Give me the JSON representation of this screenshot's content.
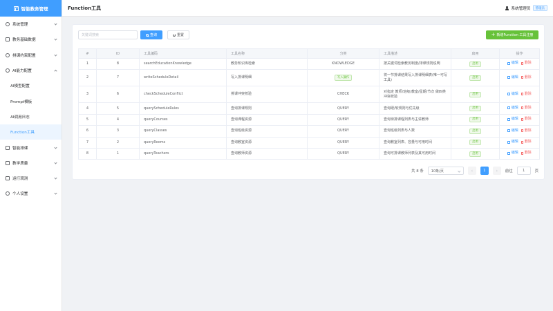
{
  "app": {
    "title": "智能教务管理"
  },
  "sidebar": {
    "items": [
      {
        "label": "系统管理",
        "icon": "gear-icon",
        "expanded": false
      },
      {
        "label": "教务基础数据",
        "icon": "monitor-icon",
        "expanded": false
      },
      {
        "label": "排课约束配置",
        "icon": "sliders-icon",
        "expanded": false
      },
      {
        "label": "AI能力配置",
        "icon": "ai-icon",
        "expanded": true
      },
      {
        "label": "智能排课",
        "icon": "calendar-icon",
        "expanded": false
      },
      {
        "label": "教学质量",
        "icon": "checkbox-icon",
        "expanded": false
      },
      {
        "label": "运行观测",
        "icon": "monitor-icon",
        "expanded": false
      },
      {
        "label": "个人设置",
        "icon": "user-icon",
        "expanded": false
      }
    ],
    "submenu": [
      {
        "label": "AI模型配置",
        "active": false
      },
      {
        "label": "Prompt模板",
        "active": false
      },
      {
        "label": "AI调用日志",
        "active": false
      },
      {
        "label": "Function工具",
        "active": true
      }
    ]
  },
  "header": {
    "title": "Function工具",
    "user": "系统管理员",
    "role": "管理员"
  },
  "toolbar": {
    "search_placeholder": "关键词搜索",
    "query_label": "查询",
    "reset_label": "重置",
    "add_label": "新增Function 工具注册"
  },
  "table": {
    "columns": [
      "#",
      "ID",
      "工具编码",
      "工具名称",
      "分类",
      "工具描述",
      "启用",
      "操作"
    ],
    "rows": [
      {
        "idx": "1",
        "id": "8",
        "code": "searchEducationKnowledge",
        "name": "教务知识库检索",
        "category": "KNOWLEDGE",
        "desc": "按关键词检索教务制度/排课规则说明",
        "status": "启用",
        "write": false
      },
      {
        "idx": "2",
        "id": "7",
        "code": "writeScheduleDetail",
        "name": "写入排课明细",
        "category": "写入操作",
        "desc": "将一节排课结果写入排课明细表(唯一可写工具)",
        "status": "启用",
        "write": true
      },
      {
        "idx": "3",
        "id": "6",
        "code": "checkScheduleConflict",
        "name": "排课冲突校验",
        "category": "CHECK",
        "desc": "对指定 教师/班级/教室/星期/节次 做四类冲突校验",
        "status": "启用",
        "write": false
      },
      {
        "idx": "4",
        "id": "5",
        "code": "queryScheduleRules",
        "name": "查询排课规则",
        "category": "QUERY",
        "desc": "查询硬/软规则与优先级",
        "status": "启用",
        "write": false
      },
      {
        "idx": "5",
        "id": "4",
        "code": "queryCourses",
        "name": "查询课程资源",
        "category": "QUERY",
        "desc": "查询待排课程列表与主讲教师",
        "status": "启用",
        "write": false
      },
      {
        "idx": "6",
        "id": "3",
        "code": "queryClasses",
        "name": "查询班级资源",
        "category": "QUERY",
        "desc": "查询班级列表与人数",
        "status": "启用",
        "write": false
      },
      {
        "idx": "7",
        "id": "2",
        "code": "queryRooms",
        "name": "查询教室资源",
        "category": "QUERY",
        "desc": "查询教室列表、容量与可用时间",
        "status": "启用",
        "write": false
      },
      {
        "idx": "8",
        "id": "1",
        "code": "queryTeachers",
        "name": "查询教师资源",
        "category": "QUERY",
        "desc": "查询可排课教师列表及其可用时间",
        "status": "启用",
        "write": false
      }
    ],
    "edit_label": "编辑",
    "delete_label": "删除"
  },
  "pagination": {
    "total_text": "共 8 条",
    "page_size": "10条/页",
    "current_page": "1",
    "goto_label": "前往",
    "goto_value": "1",
    "page_unit": "页"
  },
  "colors": {
    "primary": "#409eff",
    "success": "#67c23a",
    "danger": "#f56c6c"
  }
}
